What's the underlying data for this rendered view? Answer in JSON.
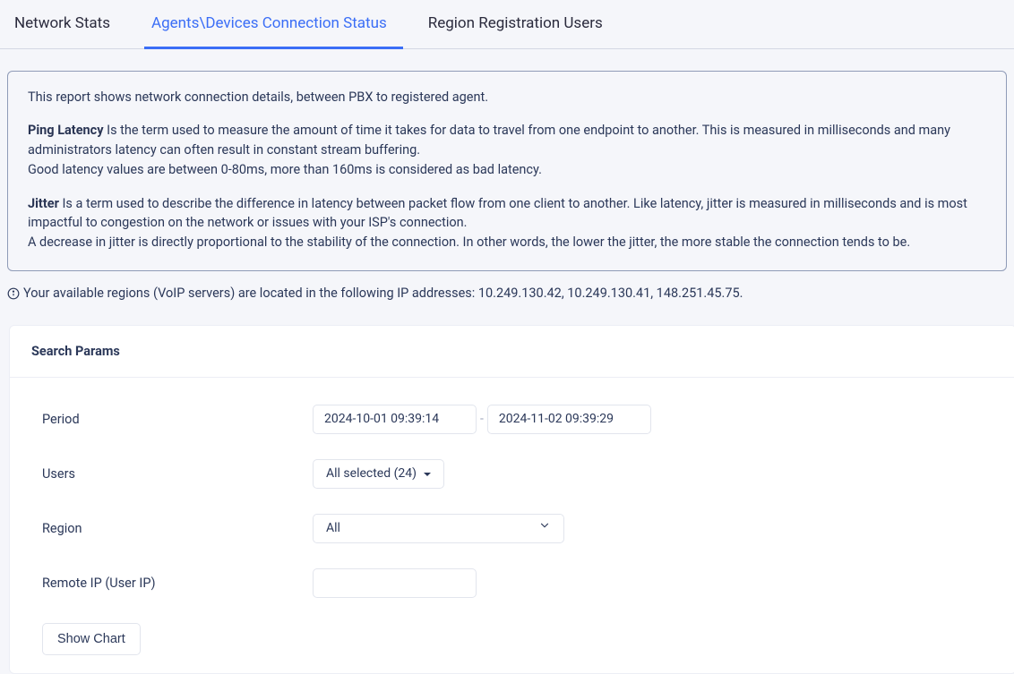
{
  "tabs": {
    "network_stats": "Network Stats",
    "agents_devices": "Agents\\Devices Connection Status",
    "region_registration": "Region Registration Users"
  },
  "info": {
    "line1": "This report shows network connection details, between PBX to registered agent.",
    "ping_label": "Ping Latency",
    "ping_text_a": " Is the term used to measure the amount of time it takes for data to travel from one endpoint to another. This is measured in milliseconds and many administrators latency can often result in constant stream buffering.",
    "ping_text_b": "Good latency values are between 0-80ms, more than 160ms is considered as bad latency.",
    "jitter_label": "Jitter",
    "jitter_text_a": " Is a term used to describe the difference in latency between packet flow from one client to another. Like latency, jitter is measured in milliseconds and is most impactful to congestion on the network or issues with your ISP's connection.",
    "jitter_text_b": "A decrease in jitter is directly proportional to the stability of the connection. In other words, the lower the jitter, the more stable the connection tends to be."
  },
  "regions_info": "Your available regions (VoIP servers) are located in the following IP addresses: 10.249.130.42, 10.249.130.41, 148.251.45.75.",
  "search": {
    "title": "Search Params",
    "period_label": "Period",
    "period_start": "2024-10-01 09:39:14",
    "period_end": "2024-11-02 09:39:29",
    "users_label": "Users",
    "users_value": "All selected (24)",
    "region_label": "Region",
    "region_value": "All",
    "remote_ip_label": "Remote IP (User IP)",
    "remote_ip_value": "",
    "show_chart_label": "Show Chart"
  }
}
